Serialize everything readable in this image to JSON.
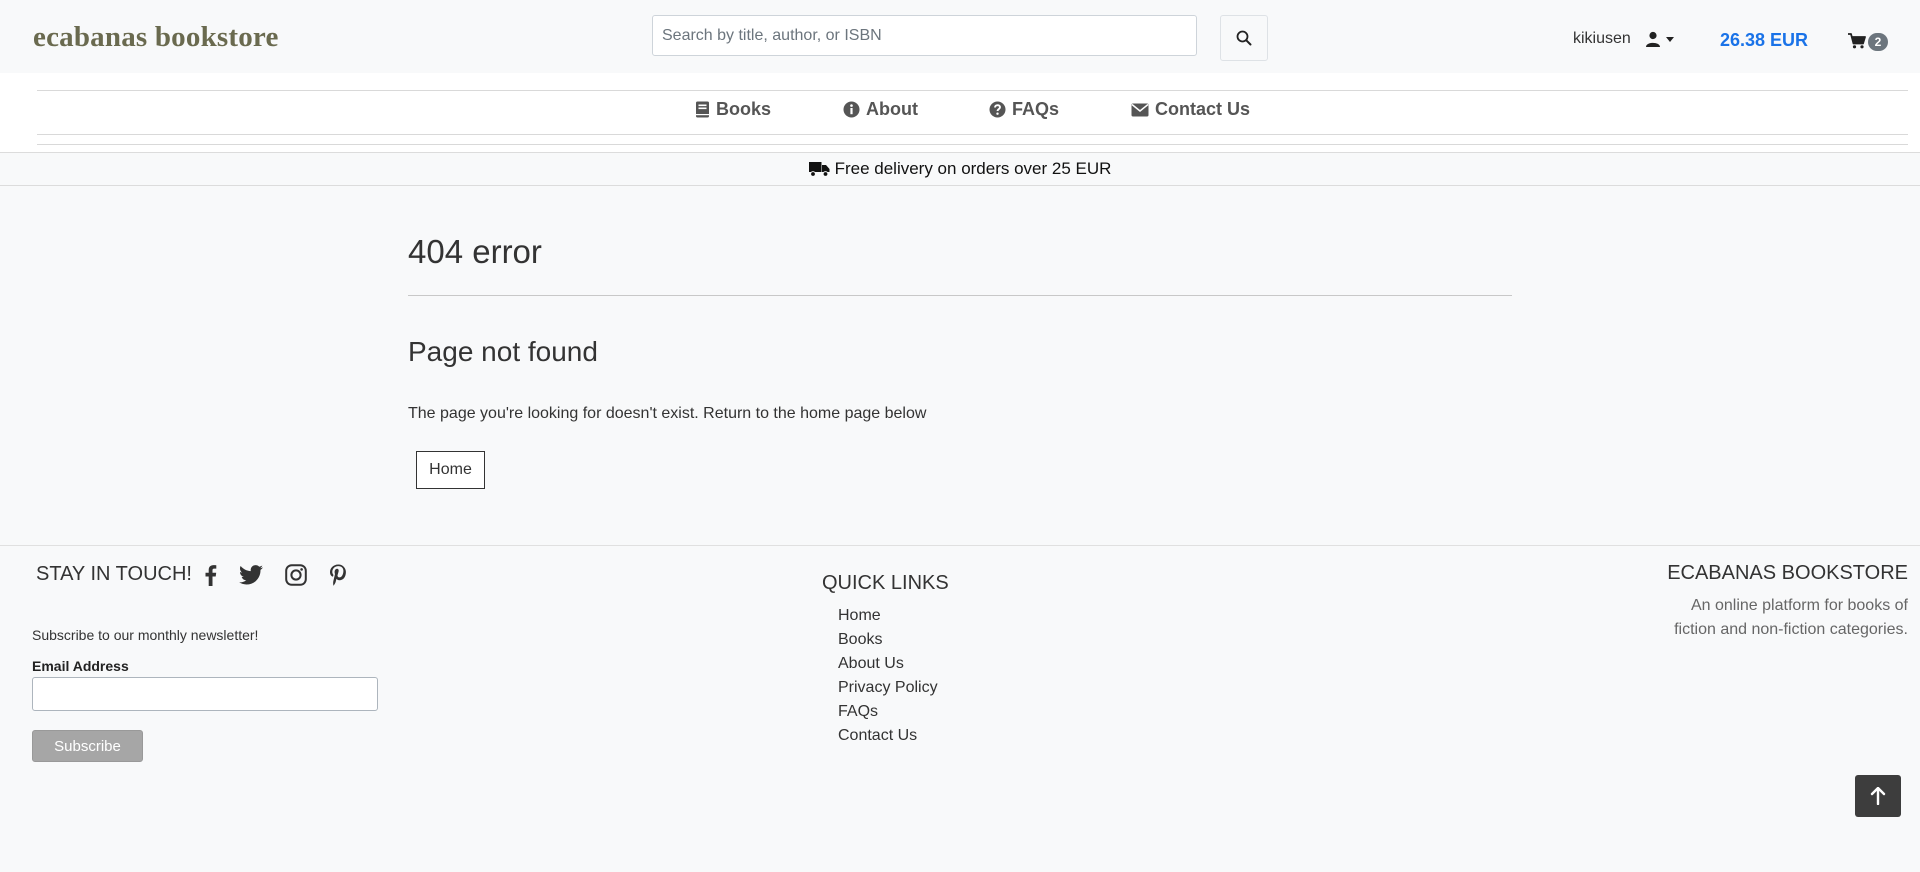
{
  "header": {
    "brand": "ecabanas bookstore",
    "search_placeholder": "Search by title, author, or ISBN",
    "username": "kikiusen",
    "balance": "26.38 EUR",
    "cart_count": "2"
  },
  "nav": {
    "items": [
      {
        "label": "Books",
        "icon": "book-icon"
      },
      {
        "label": "About",
        "icon": "info-circle-icon"
      },
      {
        "label": "FAQs",
        "icon": "question-circle-icon"
      },
      {
        "label": "Contact Us",
        "icon": "envelope-icon"
      }
    ]
  },
  "delivery": {
    "text": "Free delivery on orders over 25 EUR",
    "icon": "truck-icon"
  },
  "main": {
    "title": "404 error",
    "subtitle": "Page not found",
    "message": "The page you're looking for doesn't exist. Return to the home page below",
    "home_button": "Home"
  },
  "footer": {
    "stay_in_touch": "STAY IN TOUCH!",
    "social": [
      "facebook-icon",
      "twitter-icon",
      "instagram-icon",
      "pinterest-icon"
    ],
    "newsletter_text": "Subscribe to our monthly newsletter!",
    "email_label": "Email Address",
    "subscribe_button": "Subscribe",
    "quick_links_title": "QUICK LINKS",
    "quick_links": [
      "Home",
      "Books",
      "About Us",
      "Privacy Policy",
      "FAQs",
      "Contact Us"
    ],
    "about_title": "ECABANAS BOOKSTORE",
    "about_desc": "An online platform for books of fiction and non-fiction categories."
  },
  "colors": {
    "brand": "#6a6a4f",
    "balance": "#1a73e8",
    "background": "#f8f9fa",
    "back_to_top": "#3d3d3d"
  }
}
